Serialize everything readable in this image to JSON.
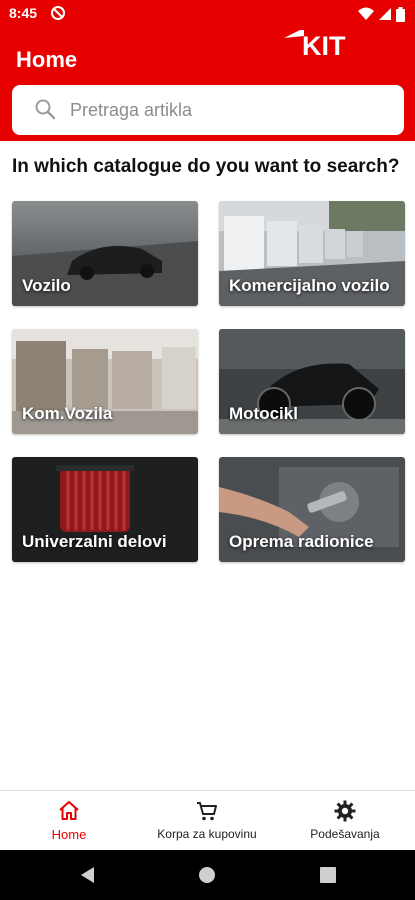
{
  "status_bar": {
    "time": "8:45"
  },
  "header": {
    "title": "Home",
    "brand": "KIT"
  },
  "search": {
    "placeholder": "Pretraga artikla"
  },
  "catalogue": {
    "heading": "In which catalogue do you want to search?",
    "tiles": [
      {
        "label": "Vozilo",
        "icon": "car-photo"
      },
      {
        "label": "Komercijalno vozilo",
        "icon": "trucks-photo"
      },
      {
        "label": "Kom.Vozila",
        "icon": "pallets-photo"
      },
      {
        "label": "Motocikl",
        "icon": "motorcycle-photo"
      },
      {
        "label": "Univerzalni delovi",
        "icon": "air-filter-photo"
      },
      {
        "label": "Oprema radionice",
        "icon": "workshop-tool-photo"
      }
    ]
  },
  "bottom_nav": {
    "items": [
      {
        "label": "Home",
        "icon": "home-icon",
        "active": true
      },
      {
        "label": "Korpa za kupovinu",
        "icon": "cart-icon",
        "active": false
      },
      {
        "label": "Podešavanja",
        "icon": "gear-icon",
        "active": false
      }
    ]
  },
  "colors": {
    "brand_red": "#e60000",
    "placeholder": "#8c8c8c"
  }
}
